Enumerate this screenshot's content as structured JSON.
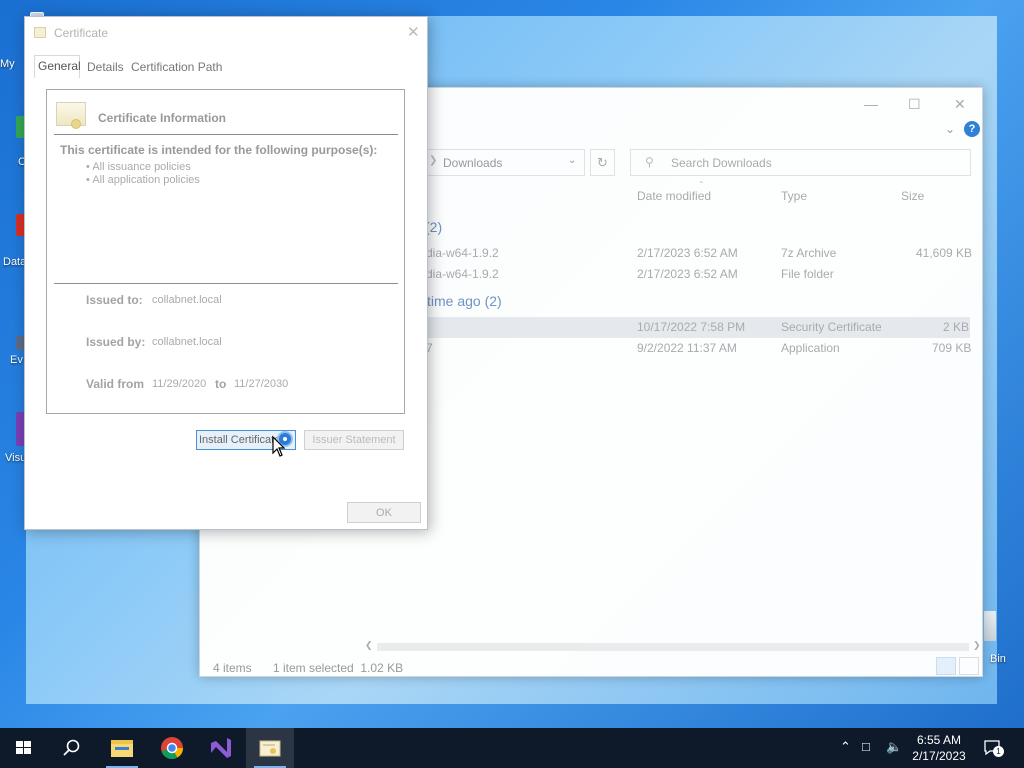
{
  "desktop": {
    "icons": [
      {
        "label": "My",
        "color": "#ffffff"
      },
      {
        "label": "C",
        "color": "#34a853"
      },
      {
        "label": "Data",
        "color": "#d93025"
      },
      {
        "label": "Ev",
        "color": "#5b6d8a"
      },
      {
        "label": "Visu",
        "color": "#7b3fb7"
      }
    ],
    "recycle_bin_label": "Bin"
  },
  "explorer": {
    "address_current": "Downloads",
    "search_placeholder": "Search Downloads",
    "columns": [
      "Date modified",
      "Type",
      "Size"
    ],
    "groups": [
      {
        "label": "(2)",
        "rows": [
          {
            "name": "dia-w64-1.9.2",
            "date": "2/17/2023 6:52 AM",
            "type": "7z Archive",
            "size": "41,609 KB"
          },
          {
            "name": "dia-w64-1.9.2",
            "date": "2/17/2023 6:52 AM",
            "type": "File folder",
            "size": ""
          }
        ]
      },
      {
        "label": "time ago (2)",
        "rows": [
          {
            "name": "",
            "date": "10/17/2022 7:58 PM",
            "type": "Security Certificate",
            "size": "2 KB",
            "selected": true
          },
          {
            "name": "7",
            "date": "9/2/2022 11:37 AM",
            "type": "Application",
            "size": "709 KB"
          }
        ]
      }
    ],
    "status": {
      "items": "4 items",
      "selected": "1 item selected  1.02 KB"
    },
    "help_label": "?"
  },
  "certificate": {
    "title": "Certificate",
    "tabs": [
      "General",
      "Details",
      "Certification Path"
    ],
    "info_title": "Certificate Information",
    "purpose_heading": "This certificate is intended for the following purpose(s):",
    "purposes": [
      "All issuance policies",
      "All application policies"
    ],
    "issued_to_label": "Issued to:",
    "issued_to": "collabnet.local",
    "issued_by_label": "Issued by:",
    "issued_by": "collabnet.local",
    "valid_from_label": "Valid from",
    "valid_from": "11/29/2020",
    "valid_to_label": "to",
    "valid_to": "11/27/2030",
    "install_button": "Install Certificate...",
    "issuer_button": "Issuer Statement",
    "ok_button": "OK"
  },
  "taskbar": {
    "time": "6:55 AM",
    "date": "2/17/2023",
    "notification_count": "1"
  }
}
